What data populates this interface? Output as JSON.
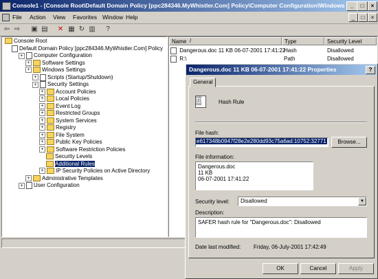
{
  "window": {
    "title": "Console1 - [Console Root\\Default Domain Policy [ppc284346.MyWhistler.Com] Policy\\Computer Configuration\\Windows ...",
    "minimize": "_",
    "restore": "□",
    "close": "×"
  },
  "menu": [
    "File",
    "Action",
    "View",
    "Favorites",
    "Window",
    "Help"
  ],
  "tree": [
    {
      "label": "Console Root",
      "depth": 0,
      "icon": "folder-icon"
    },
    {
      "label": "Default Domain Policy [ppc284346.MyWhistler.Com] Policy",
      "depth": 1,
      "icon": "policy-icon"
    },
    {
      "label": "Computer Configuration",
      "depth": 2,
      "icon": "computer-icon"
    },
    {
      "label": "Software Settings",
      "depth": 3,
      "icon": "folder-icon"
    },
    {
      "label": "Windows Settings",
      "depth": 3,
      "icon": "folder-icon"
    },
    {
      "label": "Scripts (Startup/Shutdown)",
      "depth": 4,
      "icon": "scroll-icon"
    },
    {
      "label": "Security Settings",
      "depth": 4,
      "icon": "shield-icon"
    },
    {
      "label": "Account Policies",
      "depth": 5,
      "icon": "folder-icon"
    },
    {
      "label": "Local Policies",
      "depth": 5,
      "icon": "folder-icon"
    },
    {
      "label": "Event Log",
      "depth": 5,
      "icon": "folder-icon"
    },
    {
      "label": "Restricted Groups",
      "depth": 5,
      "icon": "folder-icon"
    },
    {
      "label": "System Services",
      "depth": 5,
      "icon": "folder-icon"
    },
    {
      "label": "Registry",
      "depth": 5,
      "icon": "folder-icon"
    },
    {
      "label": "File System",
      "depth": 5,
      "icon": "folder-icon"
    },
    {
      "label": "Public Key Policies",
      "depth": 5,
      "icon": "folder-icon"
    },
    {
      "label": "Software Restriction Policies",
      "depth": 5,
      "icon": "folder-icon"
    },
    {
      "label": "Security Levels",
      "depth": 6,
      "icon": "folder-icon"
    },
    {
      "label": "Additional Rules",
      "depth": 6,
      "icon": "folder-icon",
      "selected": true
    },
    {
      "label": "IP Security Policies on Active Directory",
      "depth": 5,
      "icon": "folder-icon"
    },
    {
      "label": "Administrative Templates",
      "depth": 3,
      "icon": "folder-icon"
    },
    {
      "label": "User Configuration",
      "depth": 2,
      "icon": "user-icon"
    }
  ],
  "list": {
    "columns": [
      "Name",
      "/",
      "Type",
      "Security Level"
    ],
    "rows": [
      {
        "name": "Dangerous.doc  11  KB  06-07-2001  17:41:22",
        "type": "Hash",
        "level": "Disallowed"
      },
      {
        "name": "R:\\",
        "type": "Path",
        "level": "Disallowed"
      }
    ]
  },
  "dialog": {
    "title": "Dangerous.doc  11  KB  06-07-2001  17:41:22 Properties",
    "close": "?",
    "tab": "General",
    "rule_name": "Hash Rule",
    "file_hash_label": "File hash:",
    "file_hash_value": "e617348b0947f28e2e280dd93c75a6ad:10752:32771",
    "browse": "Browse...",
    "file_info_label": "File information:",
    "file_info": [
      "Dangerous.doc",
      "11  KB",
      "06-07-2001  17:41:22"
    ],
    "security_level_label": "Security level:",
    "security_level_value": "Disallowed",
    "description_label": "Description:",
    "description_value": "SAFER hash rule for \"Dangerous.doc\": Disallowed",
    "date_modified_label": "Date last modified:",
    "date_modified_value": "Friday, 06-July-2001   17:42:49",
    "ok": "OK",
    "cancel": "Cancel",
    "apply": "Apply"
  }
}
